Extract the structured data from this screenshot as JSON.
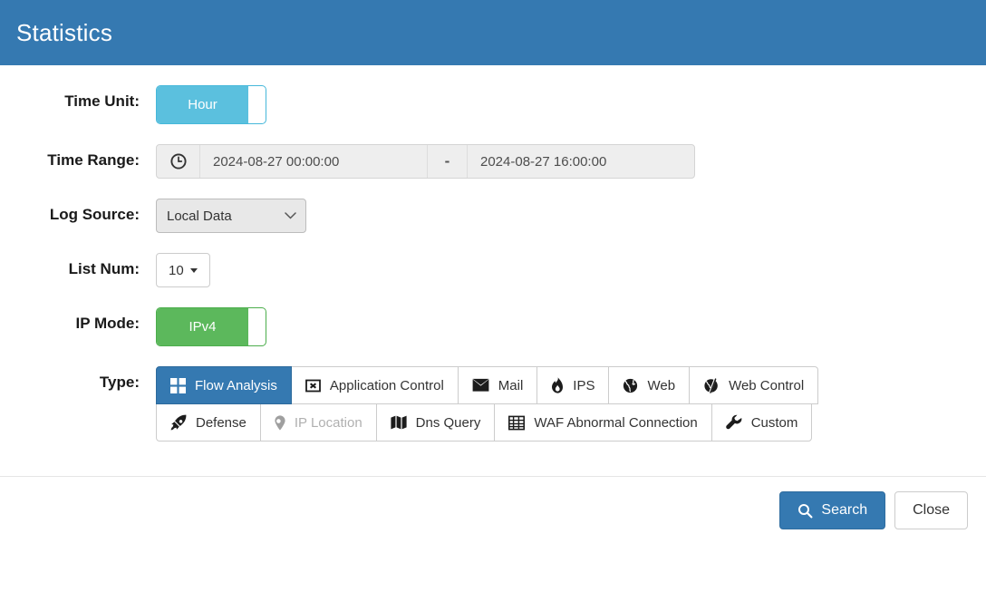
{
  "header": {
    "title": "Statistics"
  },
  "form": {
    "time_unit": {
      "label": "Time Unit:",
      "value": "Hour",
      "color": "#5bc0de"
    },
    "time_range": {
      "label": "Time Range:",
      "icon": "clock-icon",
      "start": "2024-08-27 00:00:00",
      "separator": "-",
      "end": "2024-08-27 16:00:00"
    },
    "log_source": {
      "label": "Log Source:",
      "value": "Local Data",
      "options": [
        "Local Data"
      ]
    },
    "list_num": {
      "label": "List Num:",
      "value": "10"
    },
    "ip_mode": {
      "label": "IP Mode:",
      "value": "IPv4",
      "color": "#5cb85c"
    },
    "type": {
      "label": "Type:",
      "active_color": "#3579b1",
      "buttons": [
        {
          "label": "Flow Analysis",
          "icon": "grid-icon",
          "active": true,
          "disabled": false
        },
        {
          "label": "Application Control",
          "icon": "app-box-icon",
          "active": false,
          "disabled": false
        },
        {
          "label": "Mail",
          "icon": "envelope-icon",
          "active": false,
          "disabled": false
        },
        {
          "label": "IPS",
          "icon": "fire-icon",
          "active": false,
          "disabled": false
        },
        {
          "label": "Web",
          "icon": "globe-icon",
          "active": false,
          "disabled": false
        },
        {
          "label": "Web Control",
          "icon": "globe-slash-icon",
          "active": false,
          "disabled": false
        },
        {
          "label": "Defense",
          "icon": "rocket-icon",
          "active": false,
          "disabled": false
        },
        {
          "label": "IP Location",
          "icon": "map-marker-icon",
          "active": false,
          "disabled": true
        },
        {
          "label": "Dns Query",
          "icon": "map-icon",
          "active": false,
          "disabled": false
        },
        {
          "label": "WAF Abnormal Connection",
          "icon": "table-icon",
          "active": false,
          "disabled": false
        },
        {
          "label": "Custom",
          "icon": "wrench-icon",
          "active": false,
          "disabled": false
        }
      ]
    }
  },
  "footer": {
    "search_label": "Search",
    "search_icon": "search-icon",
    "close_label": "Close"
  }
}
